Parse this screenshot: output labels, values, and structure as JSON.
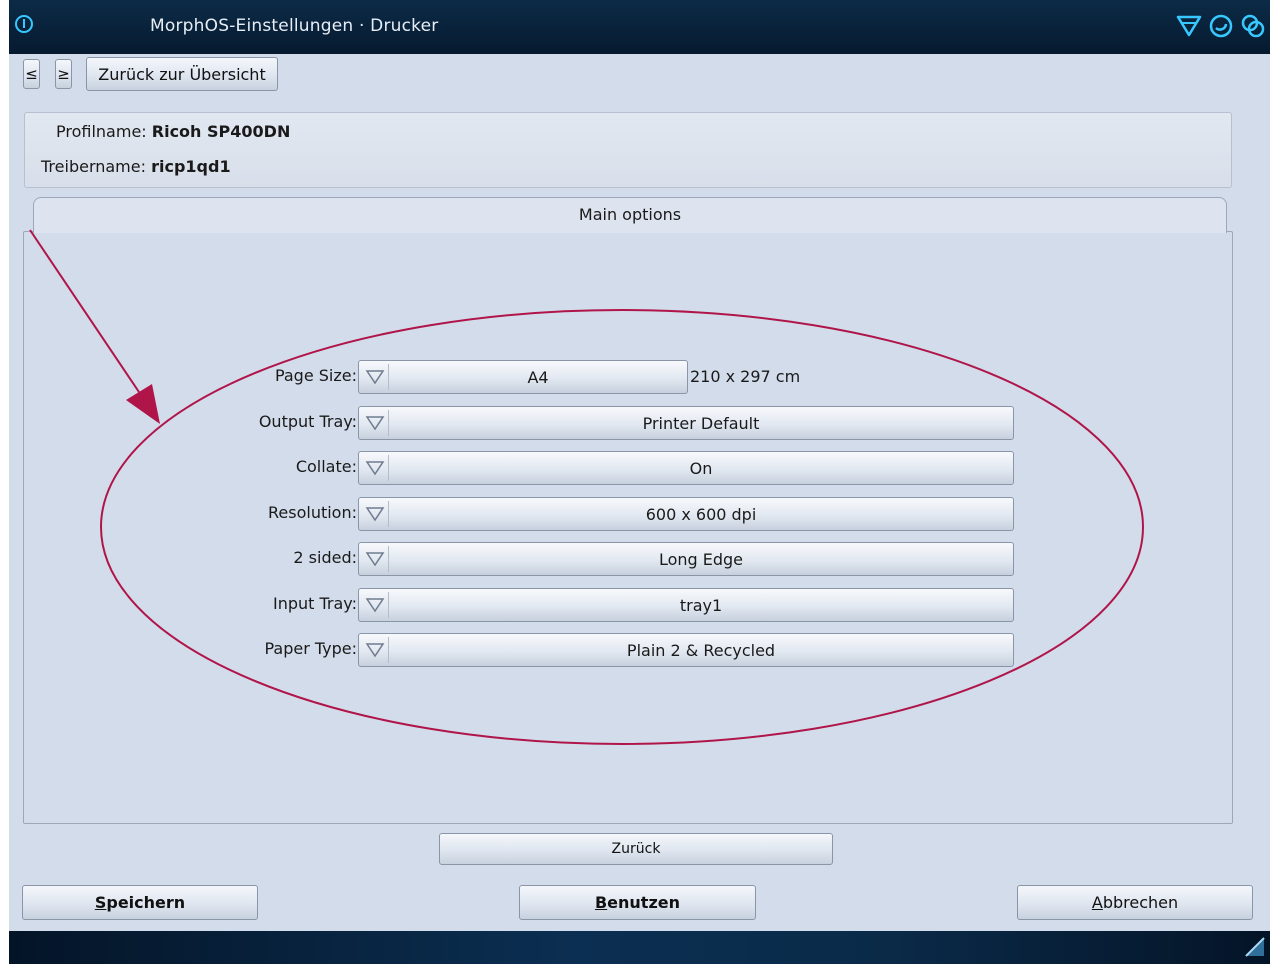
{
  "window": {
    "title": "MorphOS-Einstellungen · Drucker"
  },
  "toolbar": {
    "prev_label": "≤",
    "next_label": "≥",
    "back_label": "Zurück zur Übersicht"
  },
  "info": {
    "profile_label": "Profilname:",
    "profile_value": "Ricoh SP400DN",
    "driver_label": "Treibername:",
    "driver_value": "ricp1qd1"
  },
  "tab": {
    "label": "Main options"
  },
  "options": [
    {
      "label": "Page Size:",
      "value": "A4",
      "unit": "210 x 297 cm"
    },
    {
      "label": "Output Tray:",
      "value": "Printer Default"
    },
    {
      "label": "Collate:",
      "value": "On"
    },
    {
      "label": "Resolution:",
      "value": "600 x 600 dpi"
    },
    {
      "label": "2 sided:",
      "value": "Long Edge"
    },
    {
      "label": "Input Tray:",
      "value": "tray1"
    },
    {
      "label": "Paper Type:",
      "value": "Plain 2 & Recycled"
    }
  ],
  "actions": {
    "back_label": "Zurück",
    "save_first": "S",
    "save_rest": "peichern",
    "use_first": "B",
    "use_rest": "enutzen",
    "cancel_first": "A",
    "cancel_rest": "bbrechen"
  },
  "colors": {
    "titlebar": "#061a2f",
    "accent": "#37c8ff",
    "window_bg": "#d3dcea",
    "annotation": "#b0154a"
  }
}
